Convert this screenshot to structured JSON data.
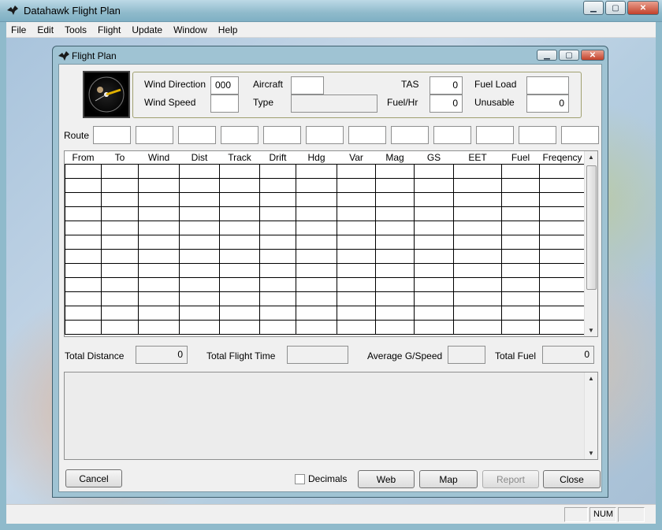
{
  "app": {
    "title": "Datahawk Flight Plan"
  },
  "menu": [
    "File",
    "Edit",
    "Tools",
    "Flight",
    "Update",
    "Window",
    "Help"
  ],
  "dialog": {
    "title": "Flight Plan",
    "labels": {
      "wind_direction": "Wind Direction",
      "wind_speed": "Wind Speed",
      "aircraft": "Aircraft",
      "type": "Type",
      "tas": "TAS",
      "fuel_hr": "Fuel/Hr",
      "fuel_load": "Fuel Load",
      "unusable": "Unusable",
      "route": "Route"
    },
    "values": {
      "wind_direction": "000",
      "wind_speed": "",
      "aircraft": "",
      "type": "",
      "tas": "0",
      "fuel_hr": "0",
      "fuel_load": "",
      "unusable": "0"
    },
    "grid": {
      "columns": [
        "From",
        "To",
        "Wind",
        "Dist",
        "Track",
        "Drift",
        "Hdg",
        "Var",
        "Mag",
        "GS",
        "EET",
        "Fuel",
        "Freqency"
      ]
    },
    "totals": {
      "total_distance_label": "Total Distance",
      "total_distance": "0",
      "total_flight_time_label": "Total Flight Time",
      "total_flight_time": "",
      "average_gspeed_label": "Average G/Speed",
      "average_gspeed": "",
      "total_fuel_label": "Total Fuel",
      "total_fuel": "0"
    },
    "buttons": {
      "cancel": "Cancel",
      "decimals": "Decimals",
      "web": "Web",
      "map": "Map",
      "report": "Report",
      "close": "Close"
    }
  },
  "status": {
    "num": "NUM"
  }
}
